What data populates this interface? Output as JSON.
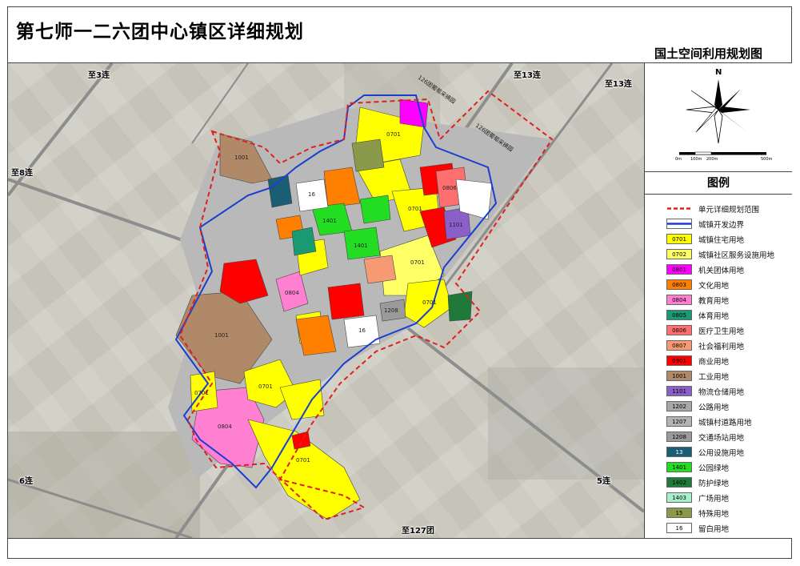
{
  "title": "第七师一二六团中心镇区详细规划",
  "subtitle": "国土空间利用规划图",
  "compass": {
    "north": "N",
    "scale_ticks": [
      "0m",
      "100m",
      "200m",
      "500m"
    ]
  },
  "legend": {
    "title": "图例",
    "items": [
      {
        "code": "",
        "label": "单元详细规划范围",
        "kind": "dash",
        "color": "#e02020"
      },
      {
        "code": "",
        "label": "城镇开发边界",
        "kind": "blue",
        "color": "#1a3fd0"
      },
      {
        "code": "0701",
        "label": "城镇住宅用地",
        "color": "#ffff00"
      },
      {
        "code": "0702",
        "label": "城镇社区服务设施用地",
        "color": "#ffff66"
      },
      {
        "code": "0801",
        "label": "机关团体用地",
        "color": "#ff00ff"
      },
      {
        "code": "0803",
        "label": "文化用地",
        "color": "#ff7f00"
      },
      {
        "code": "0804",
        "label": "教育用地",
        "color": "#ff7fd0"
      },
      {
        "code": "0805",
        "label": "体育用地",
        "color": "#1a9a73"
      },
      {
        "code": "0806",
        "label": "医疗卫生用地",
        "color": "#ff6f6f"
      },
      {
        "code": "0807",
        "label": "社会福利用地",
        "color": "#f59a73"
      },
      {
        "code": "0901",
        "label": "商业用地",
        "color": "#ff0000"
      },
      {
        "code": "1001",
        "label": "工业用地",
        "color": "#b08968"
      },
      {
        "code": "1101",
        "label": "物流仓储用地",
        "color": "#8a60c8"
      },
      {
        "code": "1202",
        "label": "公路用地",
        "color": "#a8a8a8"
      },
      {
        "code": "1207",
        "label": "城镇村道路用地",
        "color": "#b4b4b4"
      },
      {
        "code": "1208",
        "label": "交通场站用地",
        "color": "#9a9a9a"
      },
      {
        "code": "13",
        "label": "公用设施用地",
        "color": "#1b5e74"
      },
      {
        "code": "1401",
        "label": "公园绿地",
        "color": "#22dd22"
      },
      {
        "code": "1402",
        "label": "防护绿地",
        "color": "#1f7a3a"
      },
      {
        "code": "1403",
        "label": "广场用地",
        "color": "#a8f0cc"
      },
      {
        "code": "15",
        "label": "特殊用地",
        "color": "#8a9a4a"
      },
      {
        "code": "16",
        "label": "留白用地",
        "color": "#ffffff"
      }
    ]
  },
  "map_labels": {
    "to3": "至3连",
    "to13a": "至13连",
    "to13b": "至13连",
    "to8": "至8连",
    "lian6": "6连",
    "lian5": "5连",
    "to127": "至127团",
    "orchard1": "126团葡萄采摘园",
    "orchard2": "126团葡萄采摘园"
  },
  "parcels": {
    "p1001a": "1001",
    "p1001b": "1001",
    "p0804a": "0804",
    "p0804b": "0804",
    "p0701a": "0701",
    "p0701b": "0701",
    "p0701c": "0701",
    "p0701d": "0701",
    "p0701e": "0701",
    "p0701f": "0701",
    "p0701g": "0701",
    "p0806": "0806",
    "p1101": "1101",
    "p1401a": "1401",
    "p1401b": "1401",
    "p16a": "16",
    "p16b": "16",
    "p1208": "1208"
  }
}
